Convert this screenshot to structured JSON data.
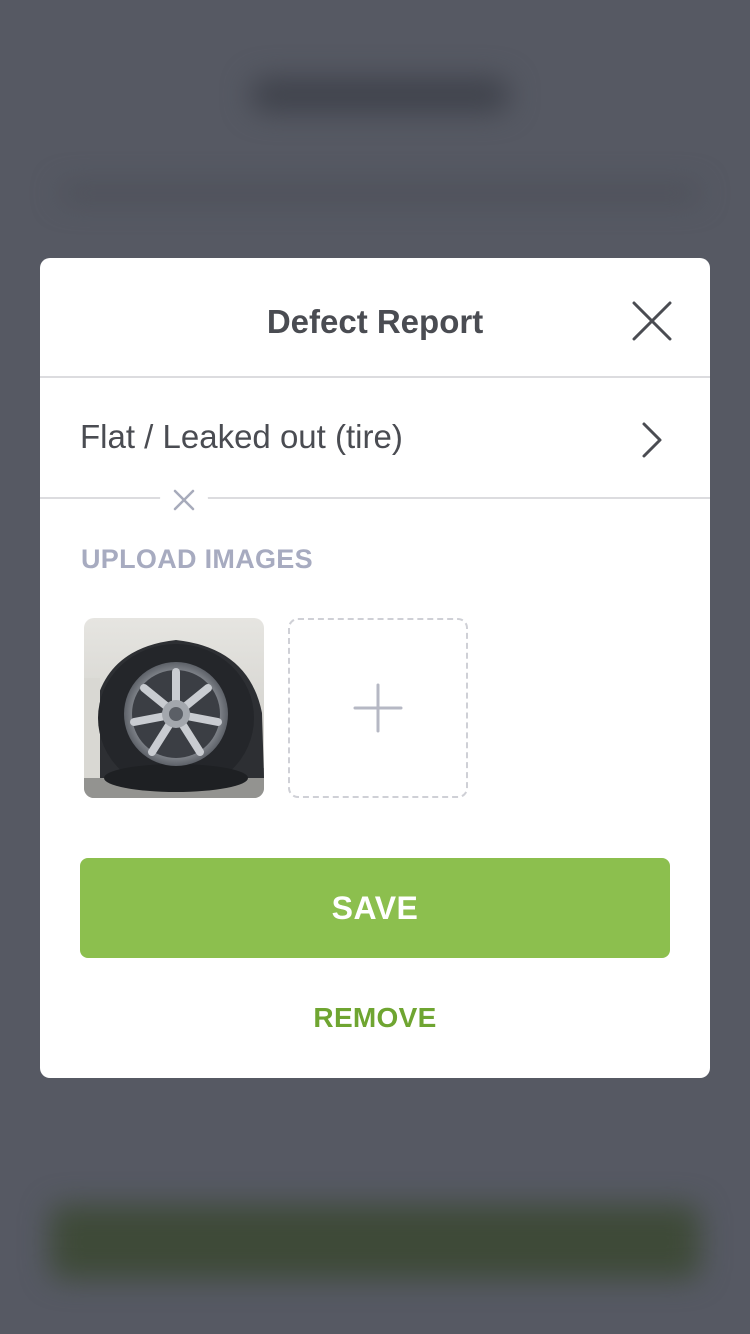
{
  "modal": {
    "title": "Defect Report",
    "close_icon": "close-icon",
    "defect": {
      "label": "Flat / Leaked out (tire)",
      "chevron_icon": "chevron-right-icon"
    },
    "upload": {
      "section_label": "UPLOAD IMAGES",
      "images": [
        {
          "alt": "flat tire photo",
          "remove_icon": "close-circle-icon"
        }
      ],
      "add_icon": "plus-icon"
    },
    "save_label": "SAVE",
    "remove_label": "REMOVE"
  },
  "colors": {
    "overlay": "#565963",
    "accent": "#8cbf4e",
    "link": "#6fa531",
    "section_label": "#a7abc0",
    "text": "#4a4c52"
  }
}
